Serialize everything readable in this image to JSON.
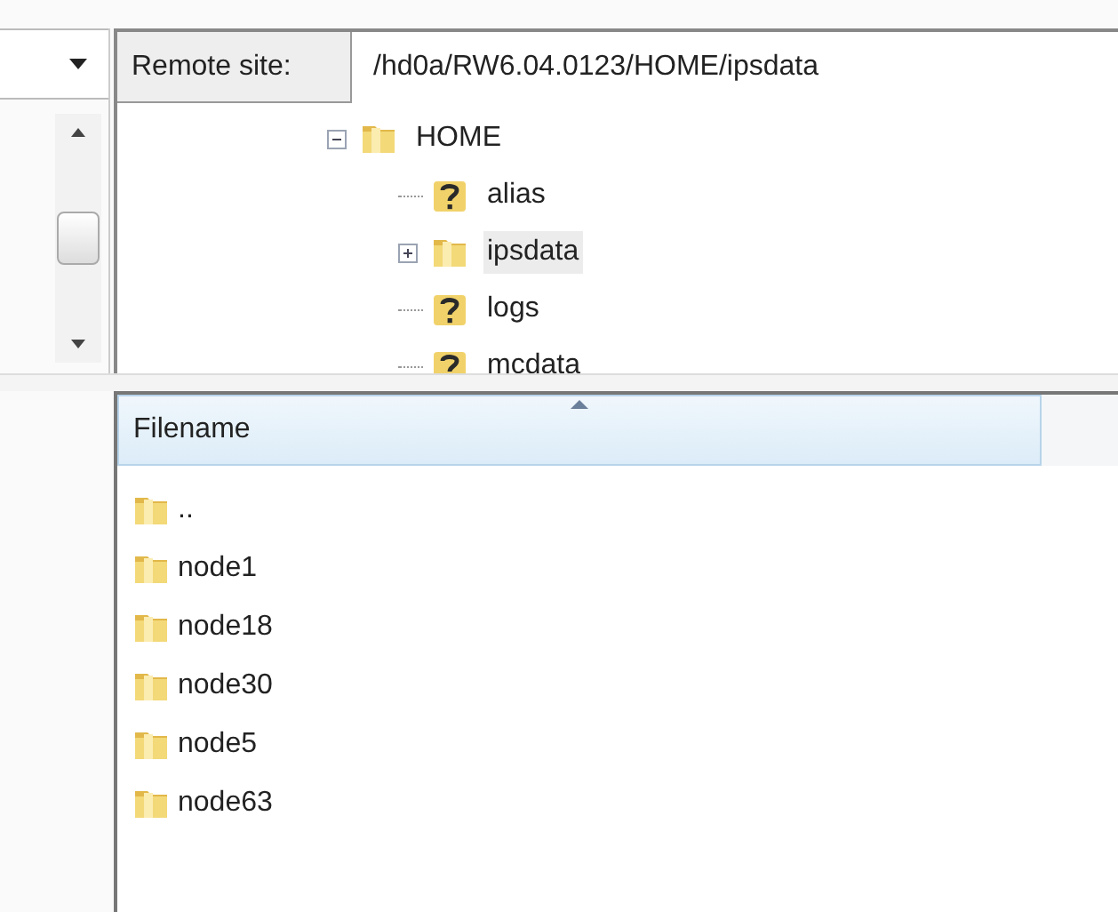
{
  "remote_site": {
    "label": "Remote site:",
    "value": "/hd0a/RW6.04.0123/HOME/ipsdata"
  },
  "tree": [
    {
      "label": "HOME",
      "kind": "folder",
      "expanded": true,
      "selected": false,
      "children": [
        {
          "label": "alias",
          "kind": "unknown",
          "selected": false
        },
        {
          "label": "ipsdata",
          "kind": "folder",
          "expanded": false,
          "selected": true
        },
        {
          "label": "logs",
          "kind": "unknown",
          "selected": false
        },
        {
          "label": "mcdata",
          "kind": "unknown",
          "selected": false
        }
      ]
    }
  ],
  "file_list": {
    "columns": [
      "Filename"
    ],
    "rows": [
      {
        "name": ".."
      },
      {
        "name": "node1"
      },
      {
        "name": "node18"
      },
      {
        "name": "node30"
      },
      {
        "name": "node5"
      },
      {
        "name": "node63"
      }
    ]
  }
}
